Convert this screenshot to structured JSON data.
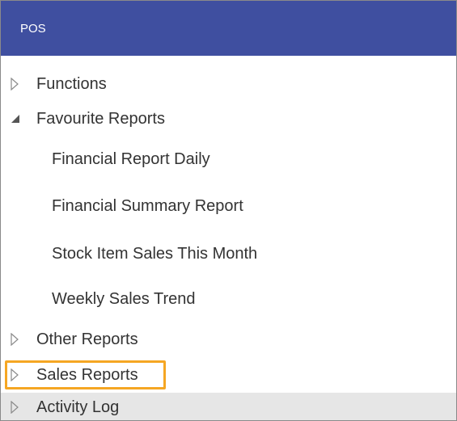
{
  "header": {
    "title": "POS"
  },
  "tree": {
    "functions": {
      "label": "Functions",
      "icon": "chevron-right-outline-icon"
    },
    "favourite_reports": {
      "label": "Favourite Reports",
      "icon": "triangle-expanded-icon",
      "children": [
        "Financial Report Daily",
        "Financial Summary Report",
        "Stock Item Sales This Month",
        "Weekly Sales Trend"
      ]
    },
    "other_reports": {
      "label": "Other Reports",
      "icon": "chevron-right-outline-icon"
    },
    "sales_reports": {
      "label": "Sales Reports",
      "icon": "chevron-right-outline-icon",
      "highlight_color": "#f5a623"
    },
    "activity_log": {
      "label": "Activity Log",
      "icon": "chevron-right-outline-icon"
    }
  },
  "colors": {
    "header_bg": "#3f4fa0",
    "text": "#333333",
    "selected_row": "#e6e6e6"
  }
}
